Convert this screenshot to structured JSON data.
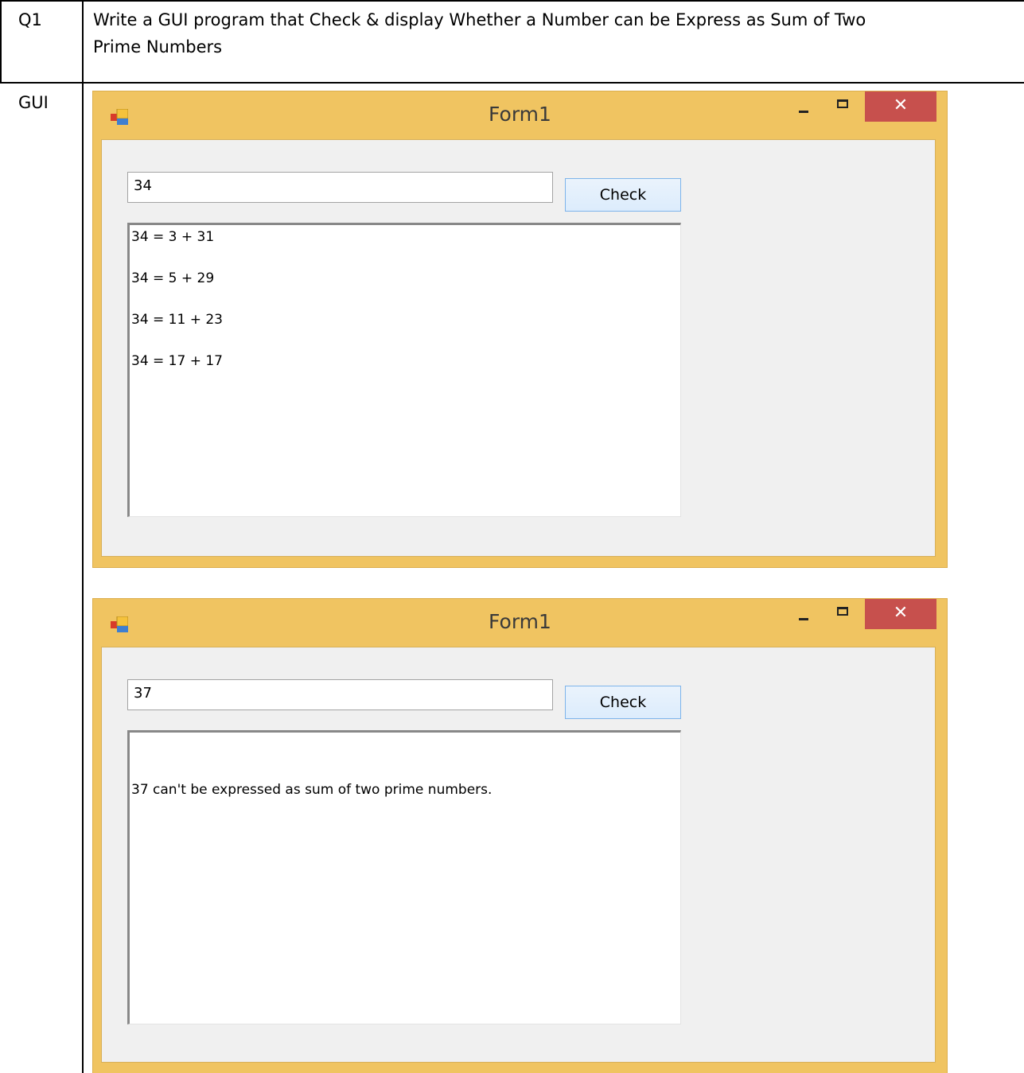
{
  "table": {
    "row1_label": "Q1",
    "row1_text_line1": "Write a GUI program that Check & display Whether a Number can be Express as Sum of Two",
    "row1_text_line2": "Prime Numbers",
    "row2_label": "GUI"
  },
  "windows": [
    {
      "title": "Form1",
      "close_glyph": "✕",
      "input_value": "34",
      "button_label": "Check",
      "results": [
        "34 = 3 + 31",
        "34 = 5 + 29",
        "34 = 11 + 23",
        "34 = 17 + 17"
      ]
    },
    {
      "title": "Form1",
      "close_glyph": "✕",
      "input_value": "37",
      "button_label": "Check",
      "results": [
        "37 can't be expressed as sum of two prime numbers."
      ]
    }
  ],
  "icons": {
    "app": "winforms-app-icon",
    "minimize": "minimize-icon",
    "maximize": "maximize-icon",
    "close": "close-icon"
  },
  "colors": {
    "window_border": "#f0c461",
    "close_button": "#c7504d",
    "client_bg": "#f0f0f0",
    "button_border": "#7eb4ea"
  }
}
